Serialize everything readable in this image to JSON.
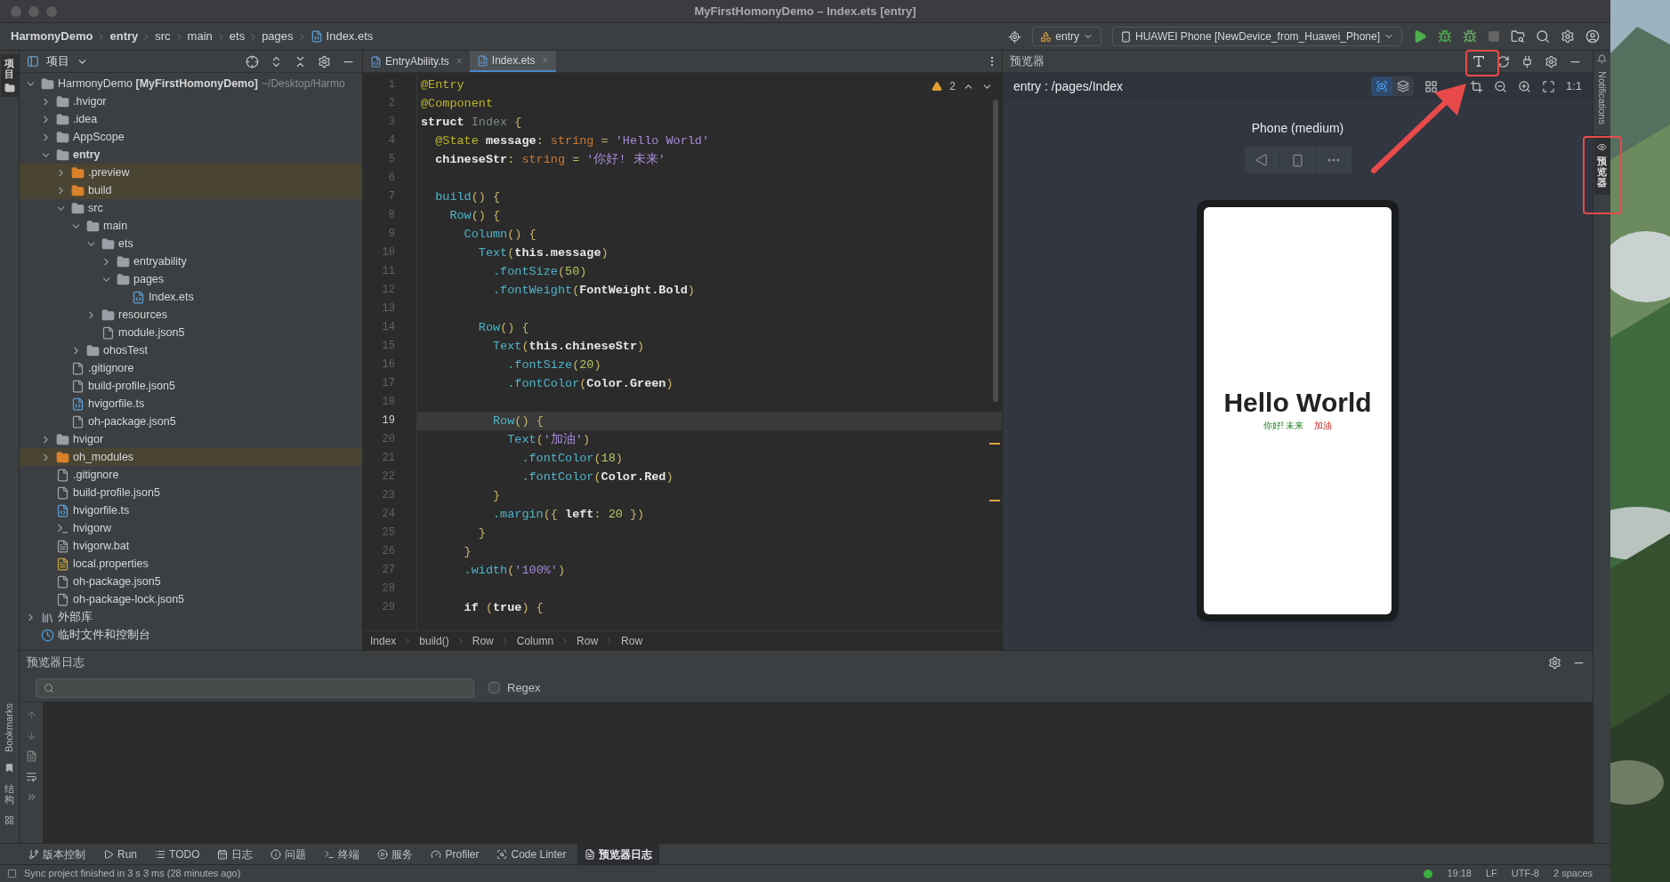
{
  "window": {
    "title": "MyFirstHomonyDemo – Index.ets [entry]"
  },
  "breadcrumb": [
    {
      "label": "HarmonyDemo",
      "bold": true,
      "kind": "dir"
    },
    {
      "label": "entry",
      "bold": true,
      "kind": "dir"
    },
    {
      "label": "src",
      "bold": false,
      "kind": "dir"
    },
    {
      "label": "main",
      "bold": false,
      "kind": "dir"
    },
    {
      "label": "ets",
      "bold": false,
      "kind": "dir"
    },
    {
      "label": "pages",
      "bold": false,
      "kind": "dir"
    },
    {
      "label": "Index.ets",
      "bold": false,
      "kind": "file"
    }
  ],
  "toolbar": {
    "module": "entry",
    "device": "HUAWEI Phone [NewDevice_from_Huawei_Phone]"
  },
  "left_strip": {
    "top": "项目",
    "bottom": [
      "Bookmarks",
      "结构"
    ]
  },
  "project": {
    "title": "项目",
    "tree": [
      {
        "label": "HarmonyDemo **[MyFirstHomonyDemo]**",
        "path": "~/Desktop/Harmo",
        "kind": "module",
        "expanded": true,
        "children": [
          {
            "label": ".hvigor",
            "kind": "folder",
            "expanded": false
          },
          {
            "label": ".idea",
            "kind": "folder",
            "expanded": false
          },
          {
            "label": "AppScope",
            "kind": "folder",
            "expanded": false
          },
          {
            "label": "entry",
            "kind": "module",
            "expanded": true,
            "children": [
              {
                "label": ".preview",
                "kind": "excluded",
                "expanded": false
              },
              {
                "label": "build",
                "kind": "excluded",
                "expanded": false
              },
              {
                "label": "src",
                "kind": "folder",
                "expanded": true,
                "children": [
                  {
                    "label": "main",
                    "kind": "folder",
                    "expanded": true,
                    "children": [
                      {
                        "label": "ets",
                        "kind": "folder",
                        "expanded": true,
                        "children": [
                          {
                            "label": "entryability",
                            "kind": "folder",
                            "expanded": false
                          },
                          {
                            "label": "pages",
                            "kind": "folder",
                            "expanded": true,
                            "children": [
                              {
                                "label": "Index.ets",
                                "kind": "ets"
                              }
                            ]
                          }
                        ]
                      },
                      {
                        "label": "resources",
                        "kind": "folder",
                        "expanded": false
                      },
                      {
                        "label": "module.json5",
                        "kind": "json"
                      }
                    ]
                  },
                  {
                    "label": "ohosTest",
                    "kind": "folder",
                    "expanded": false
                  }
                ]
              },
              {
                "label": ".gitignore",
                "kind": "git"
              },
              {
                "label": "build-profile.json5",
                "kind": "json"
              },
              {
                "label": "hvigorfile.ts",
                "kind": "ts"
              },
              {
                "label": "oh-package.json5",
                "kind": "json"
              }
            ]
          },
          {
            "label": "hvigor",
            "kind": "folder",
            "expanded": false
          },
          {
            "label": "oh_modules",
            "kind": "excluded",
            "expanded": false
          },
          {
            "label": ".gitignore",
            "kind": "git"
          },
          {
            "label": "build-profile.json5",
            "kind": "json"
          },
          {
            "label": "hvigorfile.ts",
            "kind": "ts"
          },
          {
            "label": "hvigorw",
            "kind": "script"
          },
          {
            "label": "hvigorw.bat",
            "kind": "text"
          },
          {
            "label": "local.properties",
            "kind": "props"
          },
          {
            "label": "oh-package.json5",
            "kind": "json"
          },
          {
            "label": "oh-package-lock.json5",
            "kind": "json"
          }
        ]
      },
      {
        "label": "外部库",
        "kind": "library",
        "expanded": false
      },
      {
        "label": "临时文件和控制台",
        "kind": "scratch"
      }
    ]
  },
  "editor": {
    "tabs": [
      {
        "label": "EntryAbility.ts",
        "close": "×",
        "kind": "ts",
        "selected": false
      },
      {
        "label": "Index.ets",
        "close": "×",
        "kind": "ets",
        "selected": true
      }
    ],
    "warnings": "2",
    "lines": [
      {
        "n": "1",
        "current": false,
        "tokens": [
          {
            "kind": "dec",
            "t": "@Entry"
          }
        ]
      },
      {
        "n": "2",
        "current": false,
        "tokens": [
          {
            "kind": "dec",
            "t": "@Component"
          }
        ]
      },
      {
        "n": "3",
        "current": false,
        "tokens": [
          {
            "kind": "kw",
            "t": "struct"
          },
          {
            "kind": "name",
            "t": " Index"
          },
          {
            "kind": "p",
            "t": " {"
          }
        ]
      },
      {
        "n": "4",
        "current": false,
        "tokens": [
          {
            "kind": "dec",
            "t": "  @State"
          },
          {
            "kind": "field",
            "t": " message"
          },
          {
            "kind": "p",
            "t": ": "
          },
          {
            "kind": "type",
            "t": "string"
          },
          {
            "kind": "p",
            "t": " = "
          },
          {
            "kind": "str",
            "t": "'Hello World'"
          }
        ]
      },
      {
        "n": "5",
        "current": false,
        "tokens": [
          {
            "kind": "field",
            "t": "  chineseStr"
          },
          {
            "kind": "p",
            "t": ": "
          },
          {
            "kind": "type",
            "t": "string"
          },
          {
            "kind": "p",
            "t": " = "
          },
          {
            "kind": "str",
            "t": "'你好! 未来'"
          }
        ]
      },
      {
        "n": "6",
        "current": false
      },
      {
        "n": "7",
        "current": false,
        "tokens": [
          {
            "kind": "fn",
            "t": "  build"
          },
          {
            "kind": "p",
            "t": "() {"
          }
        ]
      },
      {
        "n": "8",
        "current": false,
        "tokens": [
          {
            "kind": "fn",
            "t": "    Row"
          },
          {
            "kind": "p",
            "t": "() {"
          }
        ]
      },
      {
        "n": "9",
        "current": false,
        "tokens": [
          {
            "kind": "fn",
            "t": "      Column"
          },
          {
            "kind": "p",
            "t": "() {"
          }
        ]
      },
      {
        "n": "10",
        "current": false,
        "tokens": [
          {
            "kind": "fn",
            "t": "        Text"
          },
          {
            "kind": "p",
            "t": "("
          },
          {
            "kind": "kw",
            "t": "this"
          },
          {
            "kind": "field",
            "t": ".message"
          },
          {
            "kind": "p",
            "t": ")"
          }
        ]
      },
      {
        "n": "11",
        "current": false,
        "tokens": [
          {
            "kind": "fn",
            "t": "          .fontSize"
          },
          {
            "kind": "p",
            "t": "("
          },
          {
            "kind": "num",
            "t": "50"
          },
          {
            "kind": "p",
            "t": ")"
          }
        ]
      },
      {
        "n": "12",
        "current": false,
        "tokens": [
          {
            "kind": "fn",
            "t": "          .fontWeight"
          },
          {
            "kind": "p",
            "t": "("
          },
          {
            "kind": "field",
            "t": "FontWeight.Bold"
          },
          {
            "kind": "p",
            "t": ")"
          }
        ]
      },
      {
        "n": "13",
        "current": false
      },
      {
        "n": "14",
        "current": false,
        "tokens": [
          {
            "kind": "fn",
            "t": "        Row"
          },
          {
            "kind": "p",
            "t": "() {"
          }
        ]
      },
      {
        "n": "15",
        "current": false,
        "tokens": [
          {
            "kind": "fn",
            "t": "          Text"
          },
          {
            "kind": "p",
            "t": "("
          },
          {
            "kind": "kw",
            "t": "this"
          },
          {
            "kind": "field",
            "t": ".chineseStr"
          },
          {
            "kind": "p",
            "t": ")"
          }
        ]
      },
      {
        "n": "16",
        "current": false,
        "tokens": [
          {
            "kind": "fn",
            "t": "            .fontSize"
          },
          {
            "kind": "p",
            "t": "("
          },
          {
            "kind": "num",
            "t": "20"
          },
          {
            "kind": "p",
            "t": ")"
          }
        ]
      },
      {
        "n": "17",
        "current": false,
        "tokens": [
          {
            "kind": "fn",
            "t": "            .fontColor"
          },
          {
            "kind": "p",
            "t": "("
          },
          {
            "kind": "field",
            "t": "Color.Green"
          },
          {
            "kind": "p",
            "t": ")"
          }
        ]
      },
      {
        "n": "18",
        "current": false
      },
      {
        "n": "19",
        "current": true,
        "tokens": [
          {
            "kind": "fn",
            "t": "          Row"
          },
          {
            "kind": "p",
            "t": "() {"
          }
        ]
      },
      {
        "n": "20",
        "current": false,
        "tokens": [
          {
            "kind": "fn",
            "t": "            Text"
          },
          {
            "kind": "p",
            "t": "("
          },
          {
            "kind": "str",
            "t": "'加油'"
          },
          {
            "kind": "p",
            "t": ")"
          }
        ]
      },
      {
        "n": "21",
        "current": false,
        "tokens": [
          {
            "kind": "fn",
            "t": "              .fontColor"
          },
          {
            "kind": "p",
            "t": "("
          },
          {
            "kind": "num",
            "t": "18"
          },
          {
            "kind": "p",
            "t": ")"
          }
        ]
      },
      {
        "n": "22",
        "current": false,
        "tokens": [
          {
            "kind": "fn",
            "t": "              .fontColor"
          },
          {
            "kind": "p",
            "t": "("
          },
          {
            "kind": "field",
            "t": "Color.Red"
          },
          {
            "kind": "p",
            "t": ")"
          }
        ]
      },
      {
        "n": "23",
        "current": false,
        "tokens": [
          {
            "kind": "p",
            "t": "          }"
          }
        ]
      },
      {
        "n": "24",
        "current": false,
        "tokens": [
          {
            "kind": "fn",
            "t": "          .margin"
          },
          {
            "kind": "p",
            "t": "({ "
          },
          {
            "kind": "field",
            "t": "left"
          },
          {
            "kind": "p",
            "t": ": "
          },
          {
            "kind": "num",
            "t": "20"
          },
          {
            "kind": "p",
            "t": " })"
          }
        ]
      },
      {
        "n": "25",
        "current": false,
        "tokens": [
          {
            "kind": "p",
            "t": "        }"
          }
        ]
      },
      {
        "n": "26",
        "current": false,
        "tokens": [
          {
            "kind": "p",
            "t": "      }"
          }
        ]
      },
      {
        "n": "27",
        "current": false,
        "tokens": [
          {
            "kind": "fn",
            "t": "      .width"
          },
          {
            "kind": "p",
            "t": "("
          },
          {
            "kind": "str",
            "t": "'100%'"
          },
          {
            "kind": "p",
            "t": ")"
          }
        ]
      },
      {
        "n": "28",
        "current": false
      },
      {
        "n": "29",
        "current": false,
        "tokens": [
          {
            "kind": "kw",
            "t": "      if"
          },
          {
            "kind": "p",
            "t": " ("
          },
          {
            "kind": "kw",
            "t": "true"
          },
          {
            "kind": "p",
            "t": ") {"
          }
        ]
      }
    ],
    "breadcrumbs": [
      "Index",
      "build()",
      "Row",
      "Column",
      "Row",
      "Row"
    ]
  },
  "preview": {
    "title": "预览器",
    "route": "entry : /pages/Index",
    "ratio": "1:1",
    "device": "Phone (medium)",
    "view_toggles": [
      {
        "kind": "inspect",
        "selected": true
      },
      {
        "kind": "layers",
        "selected": false
      }
    ],
    "screen": {
      "message": "Hello World",
      "chinese": "你好! 未来",
      "cheer": "加油"
    }
  },
  "right_strip": {
    "notifications": "Notifications",
    "preview": "预览器"
  },
  "log": {
    "title": "预览器日志",
    "regex": {
      "label": "Regex",
      "checked": false
    }
  },
  "tool_tabs": [
    {
      "label": "版本控制",
      "kind": "vcs",
      "selected": false
    },
    {
      "label": "Run",
      "kind": "run",
      "selected": false
    },
    {
      "label": "TODO",
      "kind": "todo",
      "selected": false
    },
    {
      "label": "日志",
      "kind": "log",
      "selected": false
    },
    {
      "label": "问题",
      "kind": "problems",
      "selected": false
    },
    {
      "label": "终端",
      "kind": "terminal",
      "selected": false
    },
    {
      "label": "服务",
      "kind": "services",
      "selected": false
    },
    {
      "label": "Profiler",
      "kind": "profiler",
      "selected": false
    },
    {
      "label": "Code Linter",
      "kind": "linter",
      "selected": false
    },
    {
      "label": "预览器日志",
      "kind": "previewlog",
      "selected": true
    }
  ],
  "status_bar": {
    "message": "Sync project finished in 3 s 3 ms (28 minutes ago)",
    "position": "19:18",
    "line_ending": "LF",
    "encoding": "UTF-8",
    "indent": "2 spaces"
  }
}
